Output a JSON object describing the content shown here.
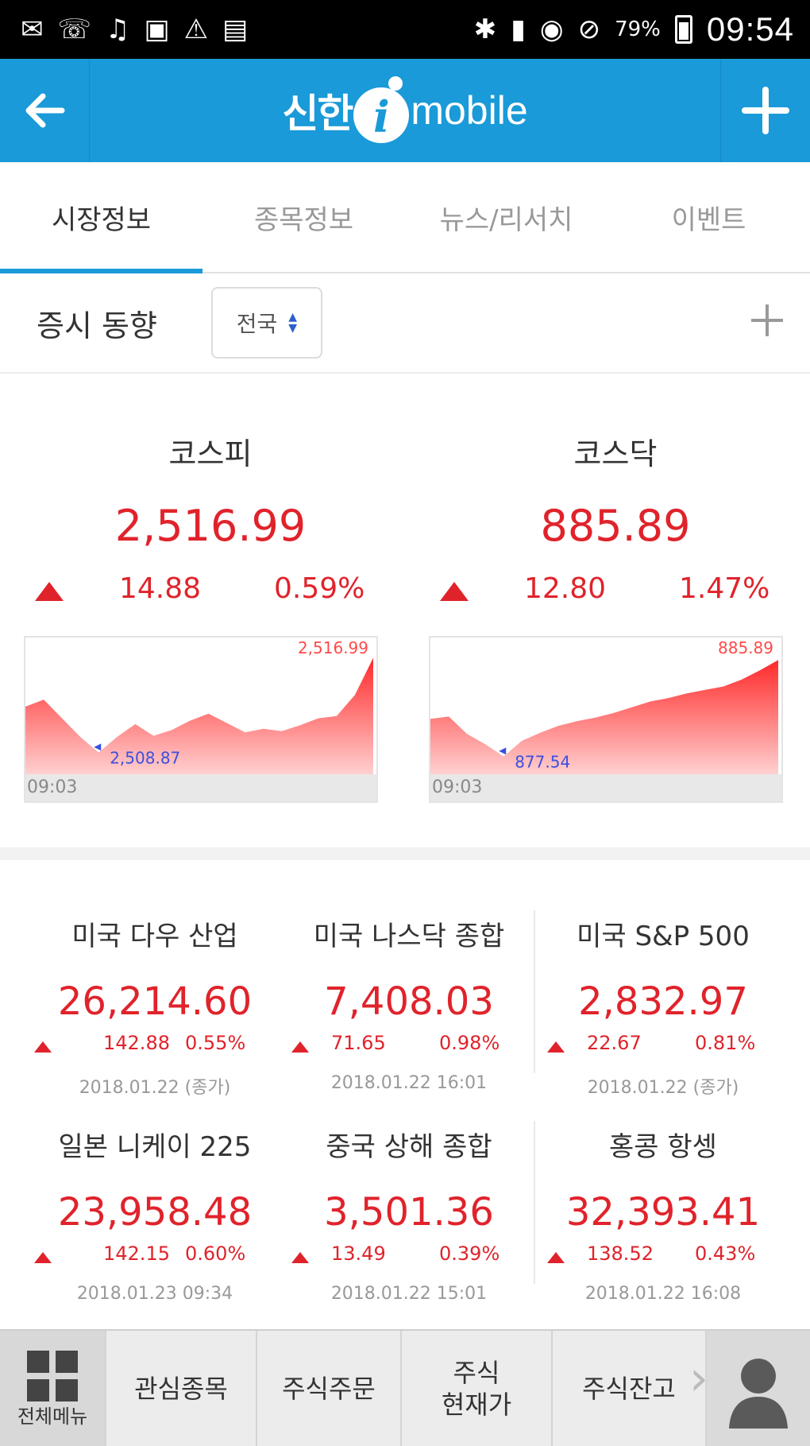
{
  "status_bar": {
    "battery": "79%",
    "time": "09:54"
  },
  "app_bar": {
    "logo_kr": "신한",
    "logo_i": "i",
    "logo_en": "mobile"
  },
  "tabs": [
    {
      "label": "시장정보",
      "active": true
    },
    {
      "label": "종목정보",
      "active": false
    },
    {
      "label": "뉴스/리서치",
      "active": false
    },
    {
      "label": "이벤트",
      "active": false
    }
  ],
  "subheader": {
    "title": "증시 동향",
    "region": "전국"
  },
  "indices": [
    {
      "name": "코스피",
      "value": "2,516.99",
      "change": "14.88",
      "pct": "0.59%",
      "chart": {
        "start_time": "09:03",
        "high_label": "2,516.99",
        "low_label": "2,508.87"
      }
    },
    {
      "name": "코스닥",
      "value": "885.89",
      "change": "12.80",
      "pct": "1.47%",
      "chart": {
        "start_time": "09:03",
        "high_label": "885.89",
        "low_label": "877.54"
      }
    }
  ],
  "chart_data": [
    {
      "type": "area",
      "title": "코스피",
      "x_start_label": "09:03",
      "annotations": [
        "2,516.99",
        "2,508.87"
      ],
      "values": [
        2512.8,
        2513.4,
        2511.8,
        2510.2,
        2508.87,
        2510.2,
        2511.3,
        2510.3,
        2510.8,
        2511.6,
        2512.2,
        2511.4,
        2510.6,
        2510.9,
        2510.7,
        2511.2,
        2511.8,
        2512.0,
        2513.8,
        2516.99
      ],
      "ylim": [
        2507.0,
        2517.5
      ],
      "color": "#ff2a2a"
    },
    {
      "type": "area",
      "title": "코스닥",
      "x_start_label": "09:03",
      "annotations": [
        "885.89",
        "877.54"
      ],
      "values": [
        880.8,
        881.0,
        879.5,
        878.6,
        877.54,
        878.9,
        879.6,
        880.2,
        880.6,
        880.9,
        881.3,
        881.8,
        882.3,
        882.6,
        883.0,
        883.3,
        883.6,
        884.2,
        885.0,
        885.89
      ],
      "ylim": [
        876.0,
        886.6
      ],
      "color": "#ff2a2a"
    }
  ],
  "world_indices": [
    {
      "name": "미국 다우 산업",
      "value": "26,214.60",
      "change": "142.88",
      "pct": "0.55%",
      "date": "2018.01.22 (종가)"
    },
    {
      "name": "미국 나스닥 종합",
      "value": "7,408.03",
      "change": "71.65",
      "pct": "0.98%",
      "date": "2018.01.22 16:01"
    },
    {
      "name": "미국 S&P 500",
      "value": "2,832.97",
      "change": "22.67",
      "pct": "0.81%",
      "date": "2018.01.22 (종가)"
    },
    {
      "name": "일본 니케이 225",
      "value": "23,958.48",
      "change": "142.15",
      "pct": "0.60%",
      "date": "2018.01.23 09:34"
    },
    {
      "name": "중국 상해 종합",
      "value": "3,501.36",
      "change": "13.49",
      "pct": "0.39%",
      "date": "2018.01.22 15:01"
    },
    {
      "name": "홍콩 항셍",
      "value": "32,393.41",
      "change": "138.52",
      "pct": "0.43%",
      "date": "2018.01.22 16:08"
    }
  ],
  "bottom_nav": {
    "all_menu": "전체메뉴",
    "items": [
      "관심종목",
      "주식주문",
      "주식\n현재가",
      "주식잔고"
    ]
  },
  "colors": {
    "accent": "#1a9ad8",
    "up": "#e0232b"
  }
}
